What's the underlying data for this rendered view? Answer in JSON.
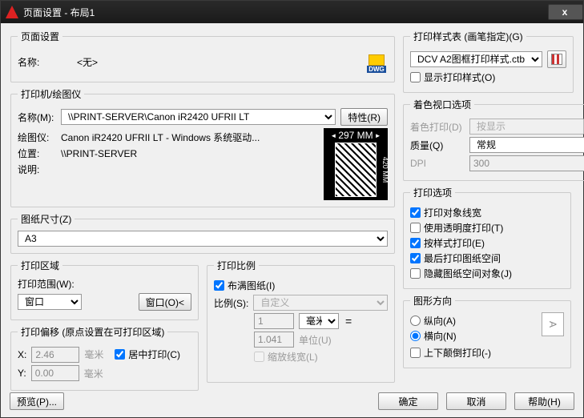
{
  "window": {
    "title": "页面设置 - 布局1"
  },
  "pageSettings": {
    "legend": "页面设置",
    "nameLabel": "名称:",
    "nameValue": "<无>",
    "dwg": "DWG"
  },
  "printer": {
    "legend": "打印机/绘图仪",
    "nameLabel": "名称(M):",
    "nameValue": "\\\\PRINT-SERVER\\Canon iR2420 UFRII LT",
    "propsBtn": "特性(R)",
    "plotterLabel": "绘图仪:",
    "plotterValue": "Canon iR2420 UFRII LT - Windows 系统驱动...",
    "locLabel": "位置:",
    "locValue": "\\\\PRINT-SERVER",
    "descLabel": "说明:",
    "descValue": "",
    "paperWidth": "297 MM",
    "paperHeight": "420 MM"
  },
  "paperSize": {
    "legend": "图纸尺寸(Z)",
    "value": "A3"
  },
  "printArea": {
    "legend": "打印区域",
    "rangeLabel": "打印范围(W):",
    "rangeValue": "窗口",
    "windowBtn": "窗口(O)<"
  },
  "offset": {
    "legend": "打印偏移 (原点设置在可打印区域)",
    "xLabel": "X:",
    "xValue": "2.46",
    "xUnit": "毫米",
    "yLabel": "Y:",
    "yValue": "0.00",
    "yUnit": "毫米",
    "centerChk": "居中打印(C)"
  },
  "scale": {
    "legend": "打印比例",
    "fitChk": "布满图纸(I)",
    "scaleLabel": "比例(S):",
    "scaleValue": "自定义",
    "mmValue": "1",
    "mmUnit": "毫米",
    "unitValue": "1.041",
    "unitUnit": "单位(U)",
    "lineScale": "缩放线宽(L)"
  },
  "styleTable": {
    "legend": "打印样式表 (画笔指定)(G)",
    "value": "DCV A2图框打印样式.ctb",
    "showChk": "显示打印样式(O)"
  },
  "viewport": {
    "legend": "着色视口选项",
    "shadeLabel": "着色打印(D)",
    "shadeValue": "按显示",
    "qualLabel": "质量(Q)",
    "qualValue": "常规",
    "dpiLabel": "DPI",
    "dpiValue": "300"
  },
  "options": {
    "legend": "打印选项",
    "lineWeight": "打印对象线宽",
    "transparency": "使用透明度打印(T)",
    "byStyle": "按样式打印(E)",
    "paperspaceLast": "最后打印图纸空间",
    "hidePaperspace": "隐藏图纸空间对象(J)"
  },
  "orientation": {
    "legend": "图形方向",
    "portrait": "纵向(A)",
    "landscape": "横向(N)",
    "upsideDown": "上下颠倒打印(-)",
    "iconLetter": "A"
  },
  "footer": {
    "preview": "预览(P)...",
    "ok": "确定",
    "cancel": "取消",
    "help": "帮助(H)"
  }
}
